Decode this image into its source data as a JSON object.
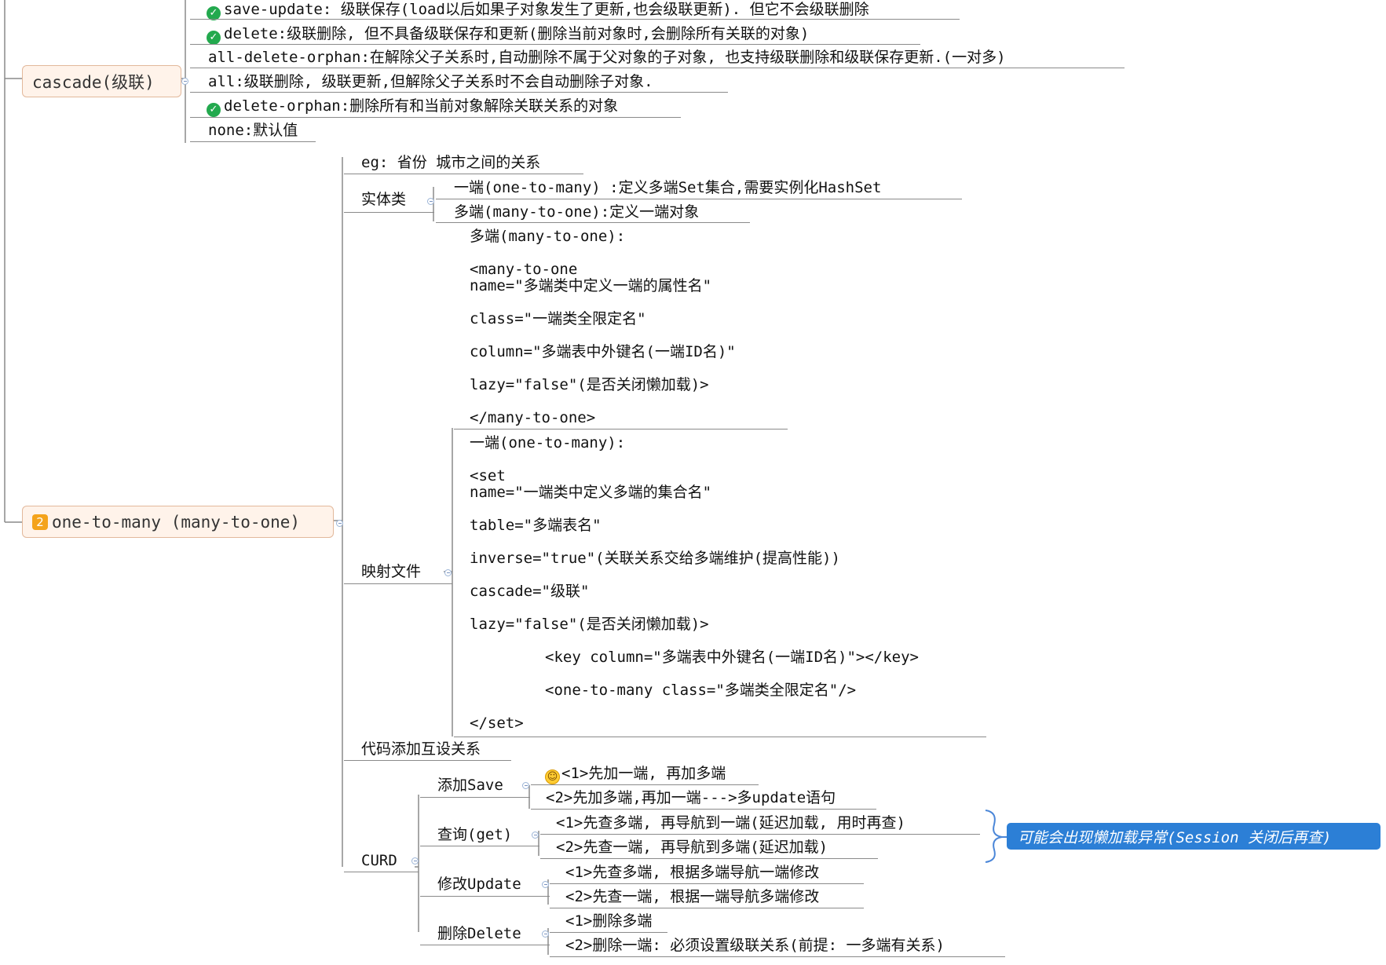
{
  "cascade": {
    "topic": "cascade(级联)",
    "options": [
      {
        "text": "save-update: 级联保存(load以后如果子对象发生了更新,也会级联更新). 但它不会级联删除",
        "checked": true
      },
      {
        "text": "delete:级联删除, 但不具备级联保存和更新(删除当前对象时,会删除所有关联的对象)",
        "checked": true
      },
      {
        "text": "all-delete-orphan:在解除父子关系时,自动删除不属于父对象的子对象, 也支持级联删除和级联保存更新.(一对多)",
        "checked": false
      },
      {
        "text": "all:级联删除, 级联更新,但解除父子关系时不会自动删除子对象.",
        "checked": false
      },
      {
        "text": "delete-orphan:删除所有和当前对象解除关联关系的对象",
        "checked": true
      },
      {
        "text": "none:默认值",
        "checked": false
      }
    ]
  },
  "relation": {
    "priority": "2",
    "topic": "one-to-many (many-to-one)",
    "example": "eg: 省份  城市之间的关系",
    "entity": {
      "label": "实体类",
      "one": "一端(one-to-many) :定义多端Set集合,需要实例化HashSet",
      "many": "多端(many-to-one):定义一端对象"
    },
    "mapping": {
      "label": "映射文件",
      "many_block": [
        "多端(many-to-one):",
        "<many-to-one",
        "name=\"多端类中定义一端的属性名\"",
        "class=\"一端类全限定名\"",
        "column=\"多端表中外键名(一端ID名)\"",
        "lazy=\"false\"(是否关闭懒加载)>",
        "</many-to-one>"
      ],
      "one_block": [
        "一端(one-to-many):",
        "<set",
        "name=\"一端类中定义多端的集合名\"",
        "table=\"多端表名\"",
        "inverse=\"true\"(关联关系交给多端维护(提高性能))",
        "cascade=\"级联\"",
        "lazy=\"false\"(是否关闭懒加载)>",
        "<key    column=\"多端表中外键名(一端ID名)\"></key>",
        "<one-to-many    class=\"多端类全限定名\"/>",
        "</set>"
      ]
    },
    "code": "代码添加互设关系",
    "curd": {
      "label": "CURD",
      "save": {
        "label": "添加Save",
        "items": [
          "<1>先加一端, 再加多端",
          "<2>先加多端,再加一端--->多update语句"
        ]
      },
      "get": {
        "label": "查询(get)",
        "items": [
          "<1>先查多端, 再导航到一端(延迟加载, 用时再查)",
          "<2>先查一端, 再导航到多端(延迟加载)"
        ]
      },
      "update": {
        "label": "修改Update",
        "items": [
          "<1>先查多端, 根据多端导航一端修改",
          "<2>先查一端, 根据一端导航多端修改"
        ]
      },
      "delete": {
        "label": "删除Delete",
        "items": [
          "<1>删除多端",
          "<2>删除一端: 必须设置级联关系(前提: 一多端有关系)"
        ]
      },
      "callout": "可能会出现懒加载异常(Session 关闭后再查)"
    }
  }
}
